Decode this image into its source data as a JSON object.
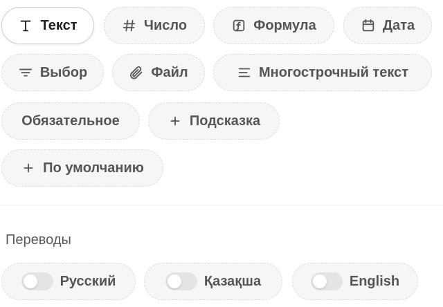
{
  "field_types": [
    {
      "label": "Текст",
      "icon": "text-type-icon",
      "active": true
    },
    {
      "label": "Число",
      "icon": "hash-icon",
      "active": false
    },
    {
      "label": "Формула",
      "icon": "function-icon",
      "active": false
    },
    {
      "label": "Дата",
      "icon": "calendar-icon",
      "active": false
    },
    {
      "label": "Выбор",
      "icon": "filter-list-icon",
      "active": false
    },
    {
      "label": "Файл",
      "icon": "paperclip-icon",
      "active": false
    },
    {
      "label": "Многострочный текст",
      "icon": "align-left-icon",
      "active": false
    }
  ],
  "options": {
    "required_label": "Обязательное",
    "hint_label": "Подсказка",
    "default_label": "По умолчанию",
    "plus_icon": "plus-icon"
  },
  "translations": {
    "title": "Переводы",
    "languages": [
      {
        "label": "Русский",
        "enabled": false
      },
      {
        "label": "Қазақша",
        "enabled": false
      },
      {
        "label": "English",
        "enabled": false
      }
    ]
  },
  "colors": {
    "chip_bg": "#f6f6f6",
    "chip_border": "#dcdcdc",
    "active_text": "#1f1f1f",
    "toggle_off": "#e4e4e4"
  }
}
